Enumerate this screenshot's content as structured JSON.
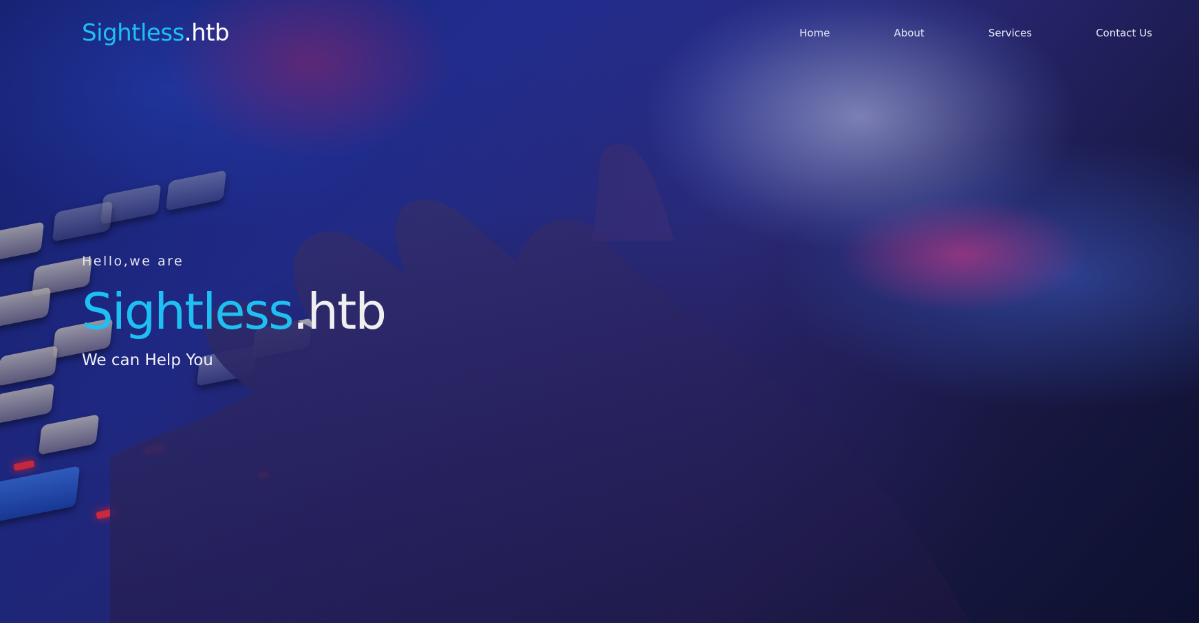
{
  "brand": {
    "name_accent": "Sightless",
    "name_suffix": ".htb"
  },
  "nav": {
    "items": [
      {
        "label": "Home"
      },
      {
        "label": "About"
      },
      {
        "label": "Services"
      },
      {
        "label": "Contact Us"
      }
    ]
  },
  "hero": {
    "greeting": "Hello,we are",
    "title_accent": "Sightless",
    "title_suffix": ".htb",
    "tagline": "We can Help You"
  },
  "colors": {
    "accent": "#1ec0f4",
    "text": "#ffffff",
    "background": "#1a2a8a"
  }
}
